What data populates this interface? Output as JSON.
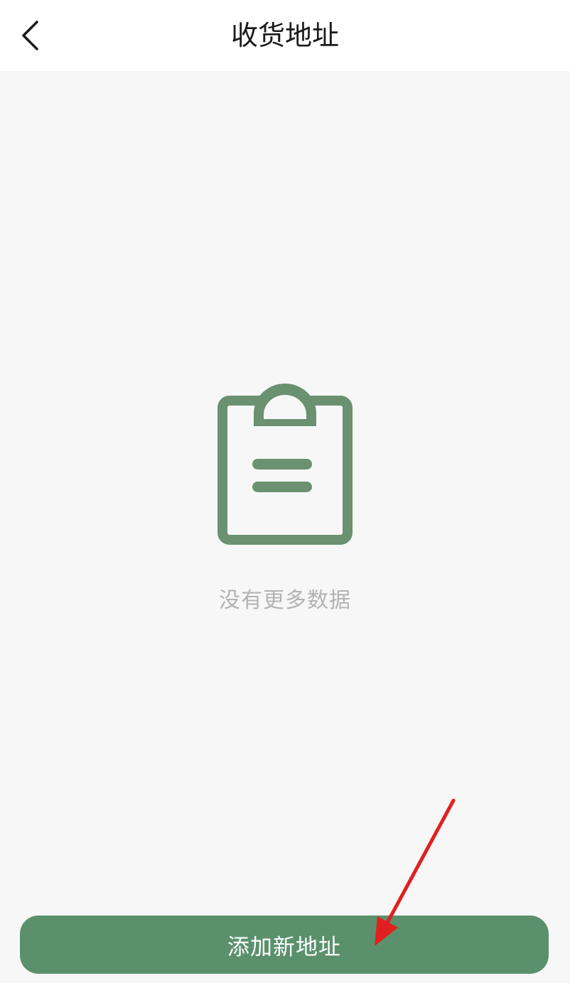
{
  "header": {
    "title": "收货地址",
    "back_icon": "chevron-left-icon"
  },
  "empty_state": {
    "icon": "clipboard-icon",
    "message": "没有更多数据"
  },
  "footer": {
    "add_button_label": "添加新地址"
  },
  "colors": {
    "accent": "#5a916c",
    "icon": "#6a9170",
    "annotation": "#e02020"
  }
}
